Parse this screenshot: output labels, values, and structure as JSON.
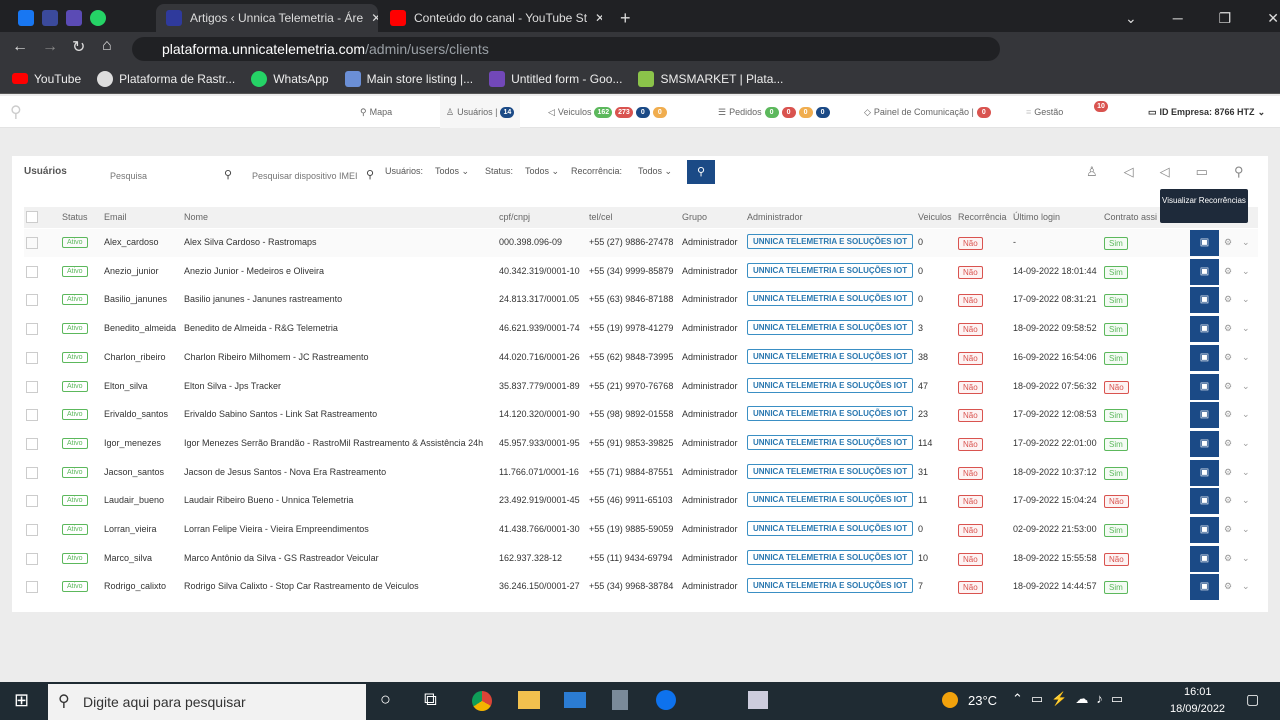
{
  "browser": {
    "tabs": [
      {
        "title": "Artigos ‹ Unnica Telemetria - Áre"
      },
      {
        "title": "Conteúdo do canal - YouTube St"
      }
    ],
    "url_host": "plataforma.unnicatelemetria.com",
    "url_path": "/admin/users/clients",
    "bookmarks": [
      "YouTube",
      "Plataforma de Rastr...",
      "WhatsApp",
      "Main store listing |...",
      "Untitled form - Goo...",
      "SMSMARKET | Plata..."
    ]
  },
  "nav": {
    "mapa": "Mapa",
    "usuarios": "Usuários |",
    "usuarios_count": "14",
    "veiculos": "Veiculos",
    "veic_counts": [
      "162",
      "273",
      "0",
      "0"
    ],
    "pedidos": "Pedidos",
    "ped_counts": [
      "0",
      "0",
      "0",
      "0"
    ],
    "painel": "Painel de Comunicação |",
    "painel_count": "0",
    "gestao": "Gestão",
    "notif_count": "10",
    "empresa": "ID Empresa: 8766 HTZ"
  },
  "toolbar": {
    "title": "Usuários",
    "search_placeholder": "Pesquisa",
    "device_placeholder": "Pesquisar dispositivo IMEI",
    "usuarios_label": "Usuários:",
    "usuarios_value": "Todos",
    "status_label": "Status:",
    "status_value": "Todos",
    "recorrencia_label": "Recorrência:",
    "recorrencia_value": "Todos"
  },
  "tooltip": "Visualizar Recorrências",
  "columns": [
    "Status",
    "Email",
    "Nome",
    "cpf/cnpj",
    "tel/cel",
    "Grupo",
    "Administrador",
    "Veiculos",
    "Recorrência",
    "Último login",
    "Contrato assi"
  ],
  "colors": {
    "primary": "#1b4a86",
    "green": "#5cb85c",
    "red": "#d9534f",
    "orange": "#f0ad4e"
  },
  "rows": [
    [
      "Ativo",
      "Alex_cardoso",
      "Alex Silva Cardoso - Rastromaps",
      "000.398.096-09",
      "+55 (27) 9886-27478",
      "Administrador",
      "UNNICA TELEMETRIA E SOLUÇÕES IOT",
      "0",
      "Não",
      "-",
      "Sim"
    ],
    [
      "Ativo",
      "Anezio_junior",
      "Anezio Junior - Medeiros e Oliveira",
      "40.342.319/0001-10",
      "+55 (34) 9999-85879",
      "Administrador",
      "UNNICA TELEMETRIA E SOLUÇÕES IOT",
      "0",
      "Não",
      "14-09-2022 18:01:44",
      "Sim"
    ],
    [
      "Ativo",
      "Basilio_janunes",
      "Basilio janunes - Janunes rastreamento",
      "24.813.317/0001.05",
      "+55 (63) 9846-87188",
      "Administrador",
      "UNNICA TELEMETRIA E SOLUÇÕES IOT",
      "0",
      "Não",
      "17-09-2022 08:31:21",
      "Sim"
    ],
    [
      "Ativo",
      "Benedito_almeida",
      "Benedito de Almeida - R&G Telemetria",
      "46.621.939/0001-74",
      "+55 (19) 9978-41279",
      "Administrador",
      "UNNICA TELEMETRIA E SOLUÇÕES IOT",
      "3",
      "Não",
      "18-09-2022 09:58:52",
      "Sim"
    ],
    [
      "Ativo",
      "Charlon_ribeiro",
      "Charlon Ribeiro Milhomem - JC Rastreamento",
      "44.020.716/0001-26",
      "+55 (62) 9848-73995",
      "Administrador",
      "UNNICA TELEMETRIA E SOLUÇÕES IOT",
      "38",
      "Não",
      "16-09-2022 16:54:06",
      "Sim"
    ],
    [
      "Ativo",
      "Elton_silva",
      "Elton Silva - Jps Tracker",
      "35.837.779/0001-89",
      "+55 (21) 9970-76768",
      "Administrador",
      "UNNICA TELEMETRIA E SOLUÇÕES IOT",
      "47",
      "Não",
      "18-09-2022 07:56:32",
      "Não"
    ],
    [
      "Ativo",
      "Erivaldo_santos",
      "Erivaldo Sabino Santos - Link Sat Rastreamento",
      "14.120.320/0001-90",
      "+55 (98) 9892-01558",
      "Administrador",
      "UNNICA TELEMETRIA E SOLUÇÕES IOT",
      "23",
      "Não",
      "17-09-2022 12:08:53",
      "Sim"
    ],
    [
      "Ativo",
      "Igor_menezes",
      "Igor Menezes Serrão Brandão - RastroMil Rastreamento & Assistência 24h",
      "45.957.933/0001-95",
      "+55 (91) 9853-39825",
      "Administrador",
      "UNNICA TELEMETRIA E SOLUÇÕES IOT",
      "114",
      "Não",
      "17-09-2022 22:01:00",
      "Sim"
    ],
    [
      "Ativo",
      "Jacson_santos",
      "Jacson de Jesus Santos - Nova Era Rastreamento",
      "11.766.071/0001-16",
      "+55 (71) 9884-87551",
      "Administrador",
      "UNNICA TELEMETRIA E SOLUÇÕES IOT",
      "31",
      "Não",
      "18-09-2022 10:37:12",
      "Sim"
    ],
    [
      "Ativo",
      "Laudair_bueno",
      "Laudair Ribeiro Bueno - Unnica Telemetria",
      "23.492.919/0001-45",
      "+55 (46) 9911-65103",
      "Administrador",
      "UNNICA TELEMETRIA E SOLUÇÕES IOT",
      "11",
      "Não",
      "17-09-2022 15:04:24",
      "Não"
    ],
    [
      "Ativo",
      "Lorran_vieira",
      "Lorran Felipe Vieira - Vieira Empreendimentos",
      "41.438.766/0001-30",
      "+55 (19) 9885-59059",
      "Administrador",
      "UNNICA TELEMETRIA E SOLUÇÕES IOT",
      "0",
      "Não",
      "02-09-2022 21:53:00",
      "Sim"
    ],
    [
      "Ativo",
      "Marco_silva",
      "Marco Antônio da Silva - GS Rastreador Veicular",
      "162.937.328-12",
      "+55 (11) 9434-69794",
      "Administrador",
      "UNNICA TELEMETRIA E SOLUÇÕES IOT",
      "10",
      "Não",
      "18-09-2022 15:55:58",
      "Não"
    ],
    [
      "Ativo",
      "Rodrigo_calixto",
      "Rodrigo Silva Calixto - Stop Car Rastreamento de Veiculos",
      "36.246.150/0001-27",
      "+55 (34) 9968-38784",
      "Administrador",
      "UNNICA TELEMETRIA E SOLUÇÕES IOT",
      "7",
      "Não",
      "18-09-2022 14:44:57",
      "Sim"
    ]
  ],
  "taskbar": {
    "search_placeholder": "Digite aqui para pesquisar",
    "weather": "23°C",
    "time": "16:01",
    "date": "18/09/2022"
  }
}
